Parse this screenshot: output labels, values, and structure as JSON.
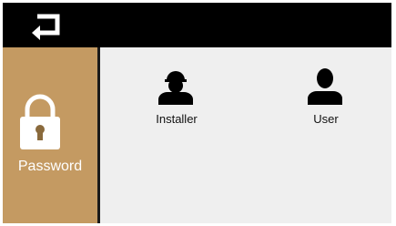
{
  "sidebar": {
    "active_label": "Password",
    "active_icon": "lock-icon",
    "accent_color": "#c49a62"
  },
  "topbar": {
    "back_icon": "return-arrow-icon"
  },
  "users": [
    {
      "label": "Installer",
      "icon": "installer-avatar-icon"
    },
    {
      "label": "User",
      "icon": "user-avatar-icon"
    }
  ]
}
